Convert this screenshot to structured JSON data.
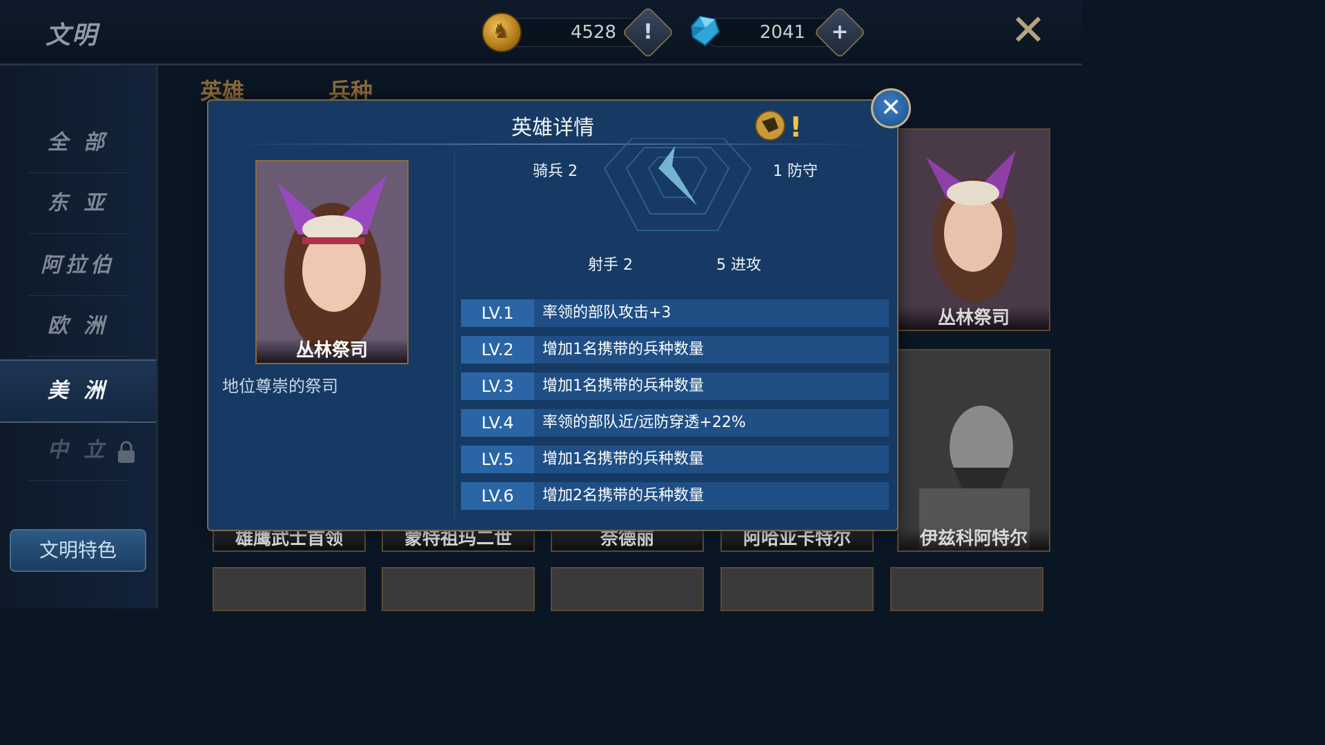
{
  "header": {
    "title": "文明",
    "gold": "4528",
    "gold_button": "!",
    "gems": "2041",
    "gems_button": "+",
    "close_glyph": "✕"
  },
  "sidebar": {
    "items": [
      {
        "label": "全 部"
      },
      {
        "label": "东 亚"
      },
      {
        "label": "阿拉伯"
      },
      {
        "label": "欧 洲"
      },
      {
        "label": "美 洲"
      },
      {
        "label": "中 立"
      }
    ],
    "active_index": 4,
    "feature_button": "文明特色"
  },
  "tabs": [
    {
      "label": "英雄"
    },
    {
      "label": "兵种"
    }
  ],
  "grid": {
    "row1": [
      "丛林祭司"
    ],
    "row2": [
      "雄鹰武士首领",
      "蒙特祖玛二世",
      "奈德丽",
      "阿哈亚卡特尔",
      "伊兹科阿特尔"
    ]
  },
  "modal": {
    "title": "英雄详情",
    "info_mark": "!",
    "close_glyph": "✕",
    "hero_name": "丛林祭司",
    "hero_desc": "地位尊崇的祭司",
    "stats": {
      "cavalry": "骑兵 2",
      "defense": "1 防守",
      "archer": "射手 2",
      "attack": "5 进攻"
    },
    "levels": [
      {
        "tag": "LV.1",
        "text": "率领的部队攻击+3"
      },
      {
        "tag": "LV.2",
        "text": "增加1名携带的兵种数量"
      },
      {
        "tag": "LV.3",
        "text": "增加1名携带的兵种数量"
      },
      {
        "tag": "LV.4",
        "text": "率领的部队近/远防穿透+22%"
      },
      {
        "tag": "LV.5",
        "text": "增加1名携带的兵种数量"
      },
      {
        "tag": "LV.6",
        "text": "增加2名携带的兵种数量"
      }
    ]
  },
  "colors": {
    "modal_bg": "#163a63",
    "level_tag": "#2a66a6",
    "level_row": "#1f4f85",
    "gold_frame": "#8a6c3a"
  }
}
